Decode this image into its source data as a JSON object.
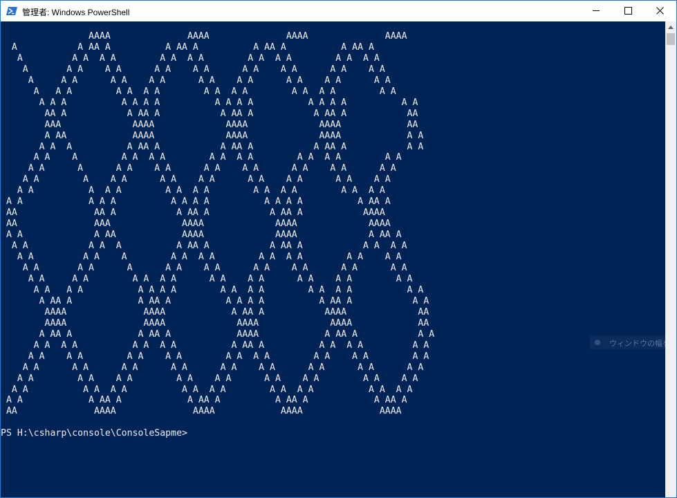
{
  "window": {
    "title": "管理者: Windows PowerShell",
    "icon": "powershell-icon",
    "controls": [
      "minimize-icon",
      "maximize-icon",
      "close-icon"
    ]
  },
  "colors": {
    "console_background": "#012456",
    "console_text": "#eeedf0",
    "titlebar_background": "#ffffff"
  },
  "console": {
    "lines": [
      "                AAAA              AAAA              AAAA              AAAA",
      "  A           A AA A          A AA A          A AA A          A AA A",
      "   A         A A  A A        A A  A A        A A  A A        A A  A A",
      "    A       A A    A A      A A    A A      A A    A A      A A    A A",
      "     A     A A      A A    A A      A A    A A      A A    A A      A A",
      "      A   A A        A A  A A        A A  A A        A A  A A        A A",
      "       A A A          A A A A          A A A A          A A A A          A A",
      "        AA A           A AA A           A AA A           A AA A           AA",
      "        AAA             AAAA             AAAA             AAAA            AA",
      "        A AA            AAAA             AAAA             AAAA            A A",
      "       A A  A          A AA A           A AA A           A AA A           A A",
      "      A A    A        A A  A A        A A  A A        A A  A A        A A",
      "     A A      A      A A    A A      A A    A A      A A    A A      A A",
      "    A A        A    A A      A A    A A      A A    A A      A A    A A",
      "   A A          A  A A        A A  A A        A A  A A        A A  A A",
      " A A            A A A          A A A A          A A A A          A AA A",
      " AA              AA A           A AA A           A AA A           AAAA",
      " AA              AAA             AAAA             AAAA             AAAA",
      " A A             A AA            AAAA             AAAA             A AA A",
      "  A A           A A  A          A AA A           A AA A           A A  A A",
      "   A A         A A    A        A A  A A        A A  A A        A A    A A",
      "    A A       A A      A      A A    A A      A A    A A      A A      A A",
      "     A A     A A        A A  A A      A A    A A      A A    A A        A A",
      "      A A   A A          A A A A        A A  A A        A A  A A          A A",
      "       A AA A            A AA A          A A A A          A AA A           A A",
      "        AAAA              AAAA            A AA A           AAAA             AA",
      "        AAAA              AAAA             AAAA             AAAA            AA",
      "       A AA A            A AA A            AAAA            A AA A           A A",
      "      A A  A A          A A  A A          A AA A          A A  A A         A A",
      "     A A    A A        A A    A A        A A  A A        A A    A A        A A",
      "    A A      A A      A A      A A      A A    A A      A A      A A      A A",
      "   A A        A A    A A        A A    A A      A A    A A        A A    A A",
      "  A A          A A  A A          A A  A A        A A  A A          A A  A A",
      " A A            A AA A            A AA A          A AA A            A AA A",
      " AA              AAAA              AAAA            AAAA              AAAA",
      "",
      "PS H:\\csharp\\console\\ConsoleSapme>"
    ]
  },
  "scrollbar": {
    "up_icon": "scroll-up-arrow-icon"
  },
  "ime_indicator": {
    "text": "ウィンドウの幅を…"
  }
}
